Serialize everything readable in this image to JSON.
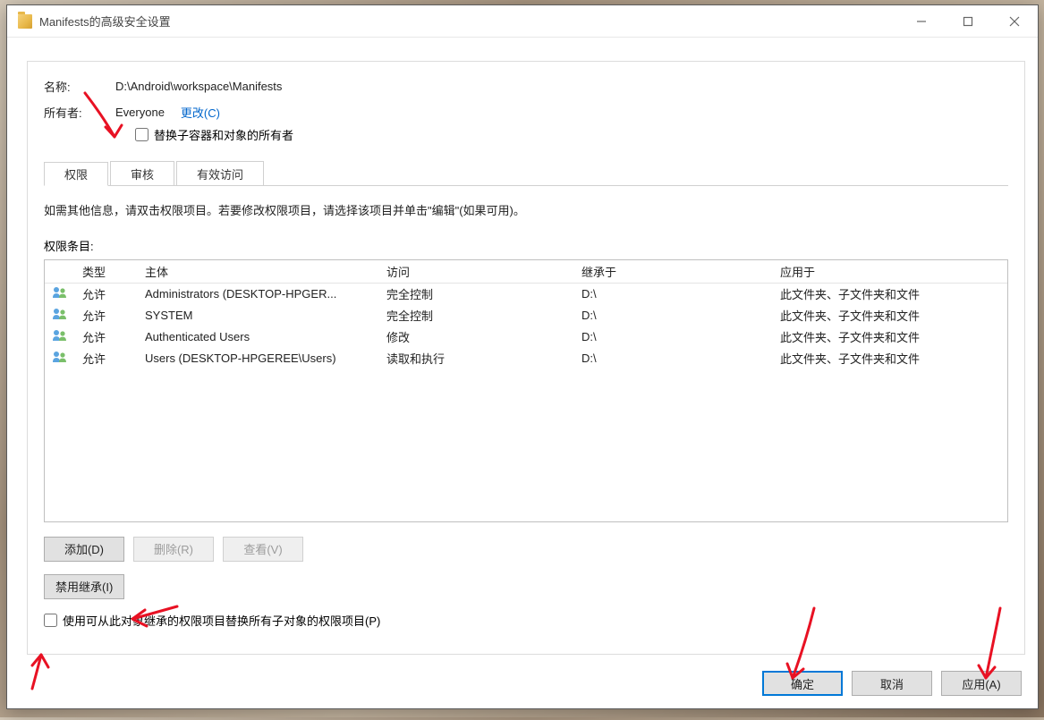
{
  "window": {
    "title": "Manifests的高级安全设置"
  },
  "fields": {
    "name_label": "名称:",
    "name_value": "D:\\Android\\workspace\\Manifests",
    "owner_label": "所有者:",
    "owner_value": "Everyone",
    "change_link": "更改(C)",
    "replace_owner_checkbox": "替换子容器和对象的所有者"
  },
  "tabs": {
    "permissions": "权限",
    "auditing": "审核",
    "effective": "有效访问"
  },
  "instructions": "如需其他信息，请双击权限项目。若要修改权限项目，请选择该项目并单击\"编辑\"(如果可用)。",
  "list_label": "权限条目:",
  "columns": {
    "type": "类型",
    "principal": "主体",
    "access": "访问",
    "inherited_from": "继承于",
    "applies_to": "应用于"
  },
  "rows": [
    {
      "type": "允许",
      "principal": "Administrators (DESKTOP-HPGER...",
      "access": "完全控制",
      "inherited_from": "D:\\",
      "applies_to": "此文件夹、子文件夹和文件"
    },
    {
      "type": "允许",
      "principal": "SYSTEM",
      "access": "完全控制",
      "inherited_from": "D:\\",
      "applies_to": "此文件夹、子文件夹和文件"
    },
    {
      "type": "允许",
      "principal": "Authenticated Users",
      "access": "修改",
      "inherited_from": "D:\\",
      "applies_to": "此文件夹、子文件夹和文件"
    },
    {
      "type": "允许",
      "principal": "Users (DESKTOP-HPGEREE\\Users)",
      "access": "读取和执行",
      "inherited_from": "D:\\",
      "applies_to": "此文件夹、子文件夹和文件"
    }
  ],
  "buttons": {
    "add": "添加(D)",
    "remove": "删除(R)",
    "view": "查看(V)",
    "disable_inherit": "禁用继承(I)",
    "replace_child_check": "使用可从此对象继承的权限项目替换所有子对象的权限项目(P)",
    "ok": "确定",
    "cancel": "取消",
    "apply": "应用(A)"
  }
}
